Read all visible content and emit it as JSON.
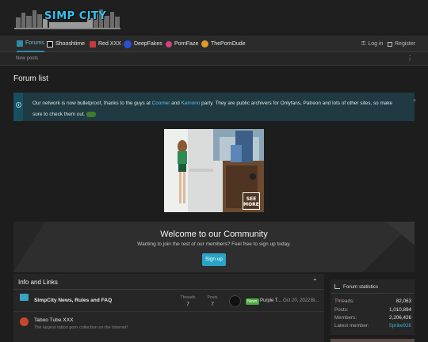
{
  "logo": {
    "text": "SIMP CITY"
  },
  "nav": {
    "tabs": [
      {
        "label": "Forums",
        "color": "#6fbcd6",
        "icon": "forums-icon"
      },
      {
        "label": "Shooshtime",
        "color": "#e2e2e2",
        "icon": "shooshtime-icon"
      },
      {
        "label": "Red XXX",
        "color": "#c33c3c",
        "icon": "red-xxx-icon"
      },
      {
        "label": "DeepFakes",
        "color": "#2b4fd3",
        "icon": "deepfakes-icon"
      },
      {
        "label": "PornFaze",
        "color": "#d1437f",
        "icon": "pornfaze-icon"
      },
      {
        "label": "ThePornDude",
        "color": "#e39a2a",
        "icon": "porndude-icon"
      }
    ],
    "login": "Log in",
    "register": "Register"
  },
  "subnav": {
    "new_posts": "New posts",
    "more": "⋮"
  },
  "page": {
    "title": "Forum list"
  },
  "notice": {
    "text_a": "Our network is now bulletproof, thanks to the guys at ",
    "link_a": "Coomer",
    "text_b": " and ",
    "link_b": "Kemono",
    "text_c": " party. They are public archivers for Onlyfans, Patreon and lots of other sites, so make sure to check them out.",
    "close": "×"
  },
  "banner": {
    "see": "SEE",
    "more": "MORE"
  },
  "welcome": {
    "title": "Welcome to our Community",
    "subtitle": "Wanting to join the rest of our members? Feel free to sign up today.",
    "signup": "Sign up"
  },
  "info_block": {
    "title": "Info and Links",
    "collapse": "⌃",
    "threads_label": "Threads",
    "posts_label": "Posts",
    "forums": [
      {
        "title": "SimpCity News, Rules and FAQ",
        "threads": "7",
        "posts": "7",
        "badge": "News",
        "last_title": "Purple T...",
        "last_date": "Oct 20, 2022",
        "last_tail": "Bi..."
      },
      {
        "title": "Taboo Tube XXX",
        "description": "The largest taboo porn collection on the internet!"
      }
    ]
  },
  "forum_stats": {
    "title": "Forum statistics",
    "rows": [
      {
        "label": "Threads:",
        "value": "82,063"
      },
      {
        "label": "Posts:",
        "value": "1,010,894"
      },
      {
        "label": "Members:",
        "value": "2,206,426"
      },
      {
        "label": "Latest member:",
        "value": "Sprike926"
      }
    ]
  }
}
